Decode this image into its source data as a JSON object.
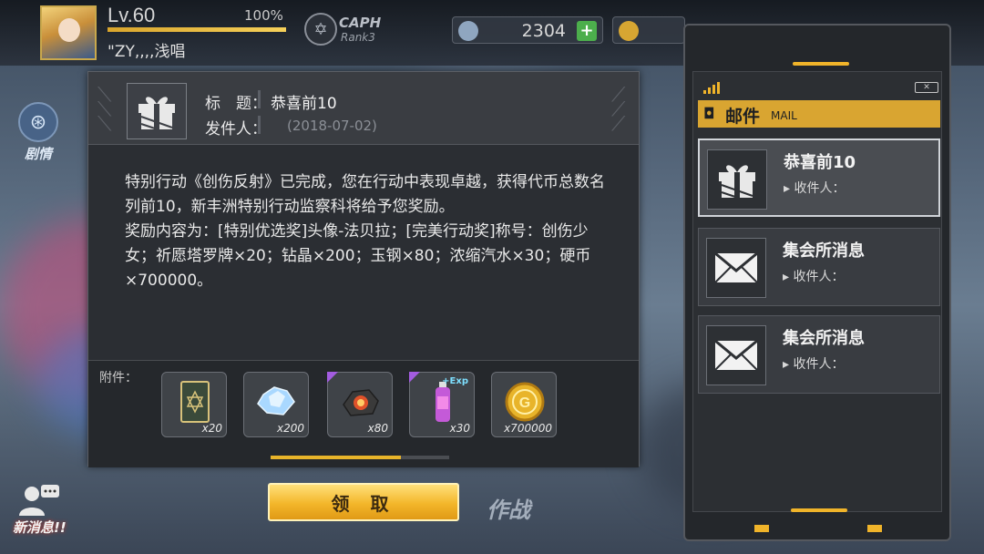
{
  "player": {
    "level": "Lv.60",
    "exp_percent": "100%",
    "exp_fraction": 1.0,
    "name": "\"ZY,,,,浅唱"
  },
  "rank_badge": {
    "label": "CAPH",
    "rank": "Rank3"
  },
  "resources": [
    {
      "icon": "diamond-icon",
      "value": "2304",
      "color": "#8fa6c0"
    },
    {
      "icon": "coin-icon",
      "value": "",
      "color": "#d7a632"
    }
  ],
  "side_buttons": [
    {
      "label": "剧情",
      "icon": "film-reel-icon"
    }
  ],
  "mail_dialog": {
    "title_label": "标　题：",
    "title_value": "恭喜前10",
    "sender_label": "发件人：",
    "date": "(2018-07-02)",
    "body": [
      "特别行动《创伤反射》已完成，您在行动中表现卓越，获得代币总数名列前10，新丰洲特别行动监察科将给予您奖励。",
      "奖励内容为：[特别优选奖]头像-法贝拉；[完美行动奖]称号：创伤少女；祈愿塔罗牌×20；钻晶×200；玉钢×80；浓缩汽水×30；硬币×700000。"
    ],
    "attachments_label": "附件：",
    "attachments": [
      {
        "icon": "tarot-card-icon",
        "qty": "x20",
        "rare": false
      },
      {
        "icon": "crystal-icon",
        "qty": "x200",
        "rare": false
      },
      {
        "icon": "steel-ore-icon",
        "qty": "x80",
        "rare": true
      },
      {
        "icon": "soda-bottle-icon",
        "qty": "x30",
        "rare": true,
        "badge": "+Exp"
      },
      {
        "icon": "gold-coin-icon",
        "qty": "x700000",
        "rare": false
      }
    ],
    "scroll_fraction": 0.73
  },
  "claim_button": {
    "label": "领 取"
  },
  "battle_label": "作战",
  "news_button": {
    "label": "新消息!!"
  },
  "mail_panel": {
    "title": "邮件",
    "title_en": "MAIL",
    "battery": "✕",
    "items": [
      {
        "icon": "gift-icon",
        "subject": "恭喜前10",
        "recipient": "▸ 收件人：",
        "selected": true
      },
      {
        "icon": "envelope-icon",
        "subject": "集会所消息",
        "recipient": "▸ 收件人：",
        "selected": false
      },
      {
        "icon": "envelope-icon",
        "subject": "集会所消息",
        "recipient": "▸ 收件人：",
        "selected": false
      }
    ]
  },
  "colors": {
    "accent": "#f0b42a",
    "panel": "#2b2e33",
    "title_bar": "#d9a531"
  }
}
